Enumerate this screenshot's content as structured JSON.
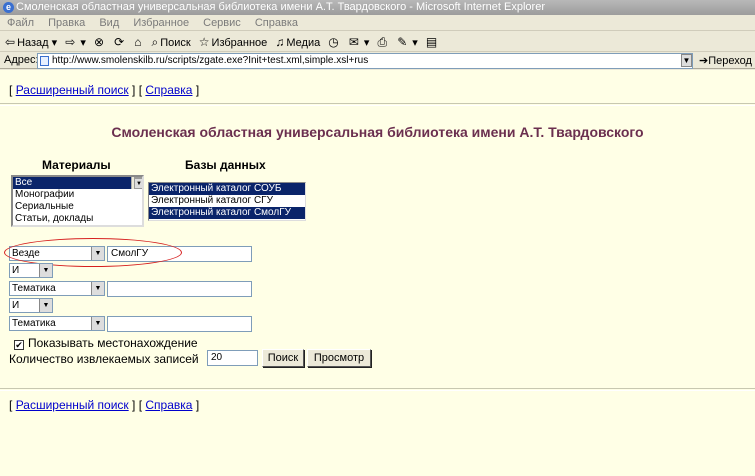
{
  "window": {
    "title": "Смоленская областная универсальная библиотека имени А.Т. Твардовского - Microsoft Internet Explorer"
  },
  "menu": [
    "Файл",
    "Правка",
    "Вид",
    "Избранное",
    "Сервис",
    "Справка"
  ],
  "toolbar": {
    "back": "Назад",
    "search": "Поиск",
    "favorites": "Избранное",
    "media": "Медиа"
  },
  "address": {
    "label": "Адрес:",
    "url": "http://www.smolenskilb.ru/scripts/zgate.exe?Init+test.xml,simple.xsl+rus",
    "go": "Переход"
  },
  "links": {
    "advanced": "Расширенный поиск",
    "help": "Справка",
    "open": "[",
    "sep": "] [",
    "close": "]"
  },
  "page_title": "Смоленская областная универсальная библиотека имени А.Т. Твардовского",
  "materials": {
    "label": "Материалы",
    "items": [
      "Все",
      "Монографии",
      "Сериальные",
      "Статьи, доклады"
    ],
    "selected": 0
  },
  "databases": {
    "label": "Базы данных",
    "items": [
      "Электронный каталог СОУБ",
      "Электронный каталог СГУ",
      "Электронный каталог СмолГУ"
    ],
    "selected": [
      0,
      2
    ]
  },
  "search_rows": [
    {
      "field": "Везде",
      "value": "СмолГУ"
    },
    {
      "op": "И"
    },
    {
      "field": "Тематика",
      "value": ""
    },
    {
      "op": "И"
    },
    {
      "field": "Тематика",
      "value": ""
    }
  ],
  "show_location": {
    "label": "Показывать местонахождение",
    "checked": true
  },
  "count": {
    "label": "Количество извлекаемых записей",
    "value": "20"
  },
  "buttons": {
    "search": "Поиск",
    "browse": "Просмотр"
  },
  "colors": {
    "heading": "#6b2f4f",
    "page_bg": "#ffffe6",
    "link": "#0000cc",
    "highlight_oval": "#d62020"
  }
}
